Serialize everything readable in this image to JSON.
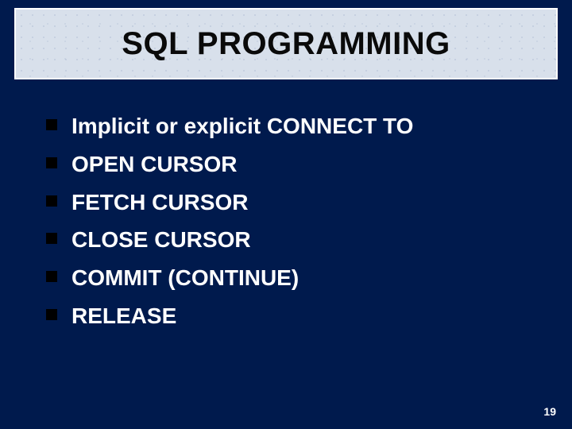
{
  "slide": {
    "title": "SQL PROGRAMMING",
    "bullets": [
      "Implicit or explicit CONNECT TO",
      "OPEN CURSOR",
      "FETCH CURSOR",
      "CLOSE CURSOR",
      "COMMIT (CONTINUE)",
      "RELEASE"
    ],
    "page_number": "19"
  }
}
